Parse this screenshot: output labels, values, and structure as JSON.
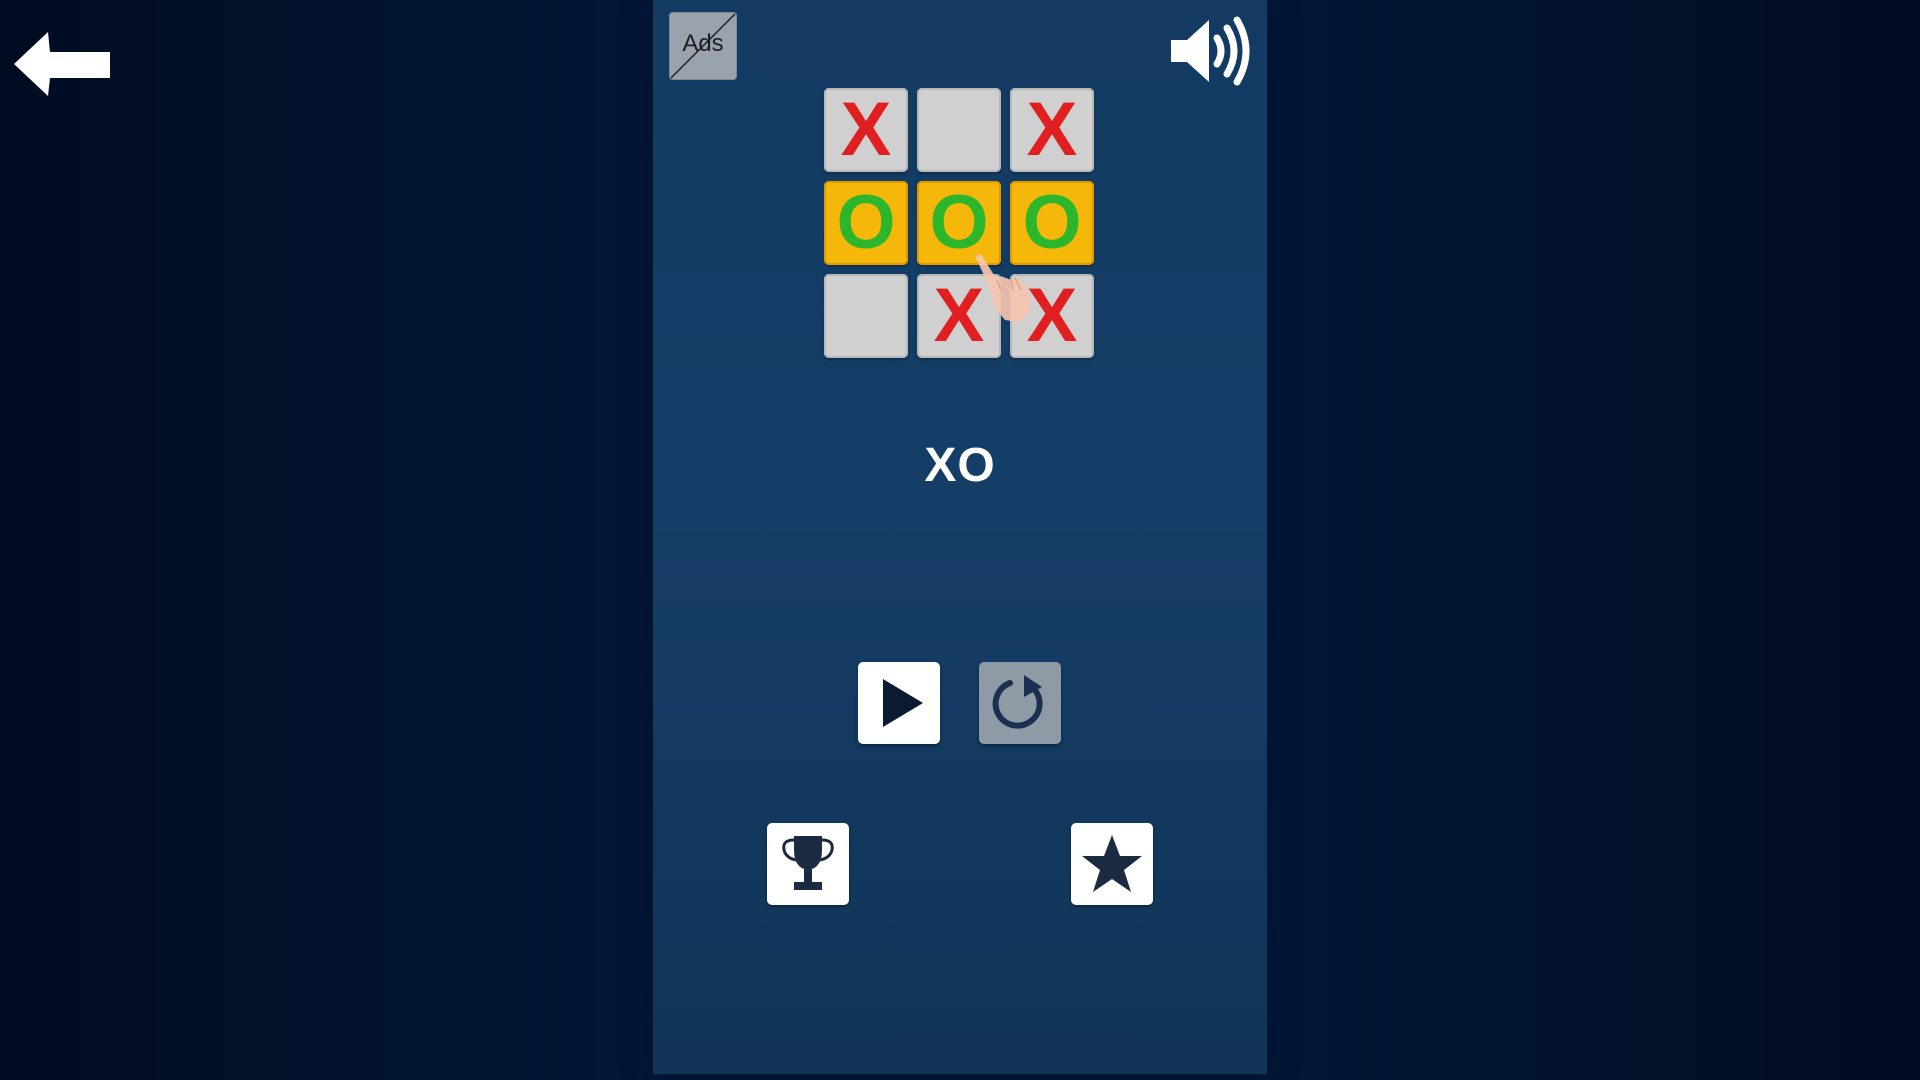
{
  "header": {
    "ads_label": "Ads"
  },
  "board": {
    "cells": [
      {
        "mark": "X",
        "win": false
      },
      {
        "mark": "",
        "win": false
      },
      {
        "mark": "X",
        "win": false
      },
      {
        "mark": "O",
        "win": true
      },
      {
        "mark": "O",
        "win": true
      },
      {
        "mark": "O",
        "win": true
      },
      {
        "mark": "",
        "win": false
      },
      {
        "mark": "X",
        "win": false
      },
      {
        "mark": "X",
        "win": false
      }
    ]
  },
  "title": "XO",
  "icons": {
    "back": "back-arrow-icon",
    "sound": "speaker-icon",
    "play": "play-icon",
    "restart": "restart-icon",
    "trophy": "trophy-icon",
    "rate": "star-icon",
    "hand": "pointing-hand-icon"
  },
  "colors": {
    "background": "#010e25",
    "panel": "#143e68",
    "x_mark": "#e02020",
    "o_mark": "#2bb62b",
    "win_cell": "#f5b80a",
    "empty_cell": "#d0d0d0",
    "disabled_button": "#8e9aa6"
  }
}
